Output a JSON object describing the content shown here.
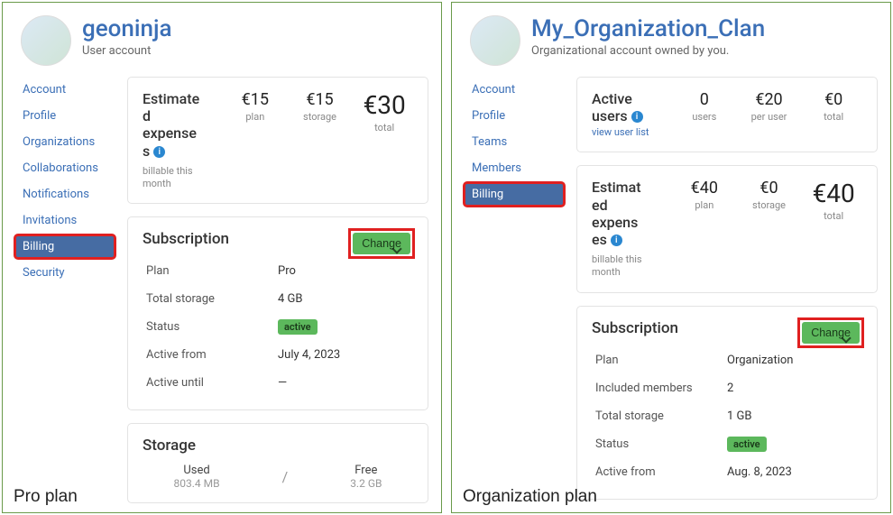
{
  "left": {
    "title": "geoninja",
    "subtitle": "User account",
    "sidebar": [
      "Account",
      "Profile",
      "Organizations",
      "Collaborations",
      "Notifications",
      "Invitations",
      "Billing",
      "Security"
    ],
    "activeIndex": 6,
    "expenses": {
      "heading_l1": "Estimate",
      "heading_l2": "d",
      "heading_l3": "expense",
      "heading_l4": "s",
      "note": "billable this month",
      "metrics": [
        {
          "value": "€15",
          "label": "plan"
        },
        {
          "value": "€15",
          "label": "storage"
        },
        {
          "value": "€30",
          "label": "total",
          "big": true
        }
      ]
    },
    "subscription": {
      "heading": "Subscription",
      "change": "Change",
      "rows": [
        {
          "k": "Plan",
          "v": "Pro"
        },
        {
          "k": "Total storage",
          "v": "4 GB"
        },
        {
          "k": "Status",
          "v": "active",
          "badge": true
        },
        {
          "k": "Active from",
          "v": "July 4, 2023"
        },
        {
          "k": "Active until",
          "v": "—"
        }
      ]
    },
    "storage": {
      "heading": "Storage",
      "used_l": "Used",
      "used_v": "803.4 MB",
      "sep": "/",
      "free_l": "Free",
      "free_v": "3.2 GB"
    },
    "caption": "Pro plan"
  },
  "right": {
    "title": "My_Organization_Clan",
    "subtitle": "Organizational account owned by you.",
    "sidebar": [
      "Account",
      "Profile",
      "Teams",
      "Members",
      "Billing"
    ],
    "activeIndex": 4,
    "activeUsers": {
      "heading": "Active users",
      "link": "view user list",
      "metrics": [
        {
          "value": "0",
          "label": "users"
        },
        {
          "value": "€20",
          "label": "per user"
        },
        {
          "value": "€0",
          "label": "total"
        }
      ]
    },
    "expenses": {
      "heading_l1": "Estimat",
      "heading_l2": "ed",
      "heading_l3": "expens",
      "heading_l4": "es",
      "note": "billable this month",
      "metrics": [
        {
          "value": "€40",
          "label": "plan"
        },
        {
          "value": "€0",
          "label": "storage"
        },
        {
          "value": "€40",
          "label": "total",
          "big": true
        }
      ]
    },
    "subscription": {
      "heading": "Subscription",
      "change": "Change",
      "rows": [
        {
          "k": "Plan",
          "v": "Organization"
        },
        {
          "k": "Included members",
          "v": "2"
        },
        {
          "k": "Total storage",
          "v": "1 GB"
        },
        {
          "k": "Status",
          "v": "active",
          "badge": true
        },
        {
          "k": "Active from",
          "v": "Aug. 8, 2023"
        }
      ]
    },
    "caption": "Organization plan"
  }
}
